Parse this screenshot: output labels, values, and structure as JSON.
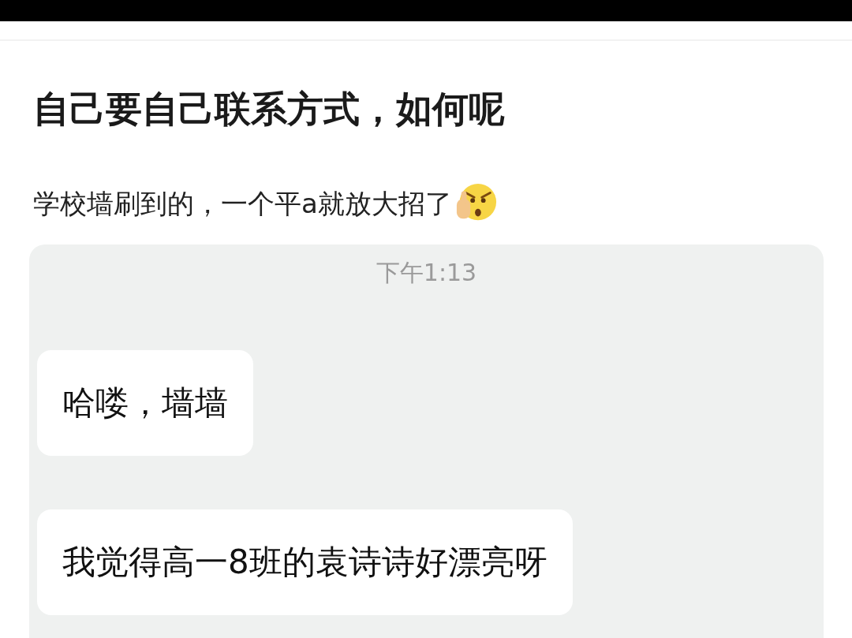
{
  "post": {
    "title": "自己要自己联系方式，如何呢",
    "body": "学校墙刷到的，一个平a就放大招了"
  },
  "chat": {
    "time": "下午1:13",
    "messages": [
      {
        "text": "哈喽，墙墙"
      },
      {
        "text": "我觉得高一8班的袁诗诗好漂亮呀"
      }
    ]
  }
}
